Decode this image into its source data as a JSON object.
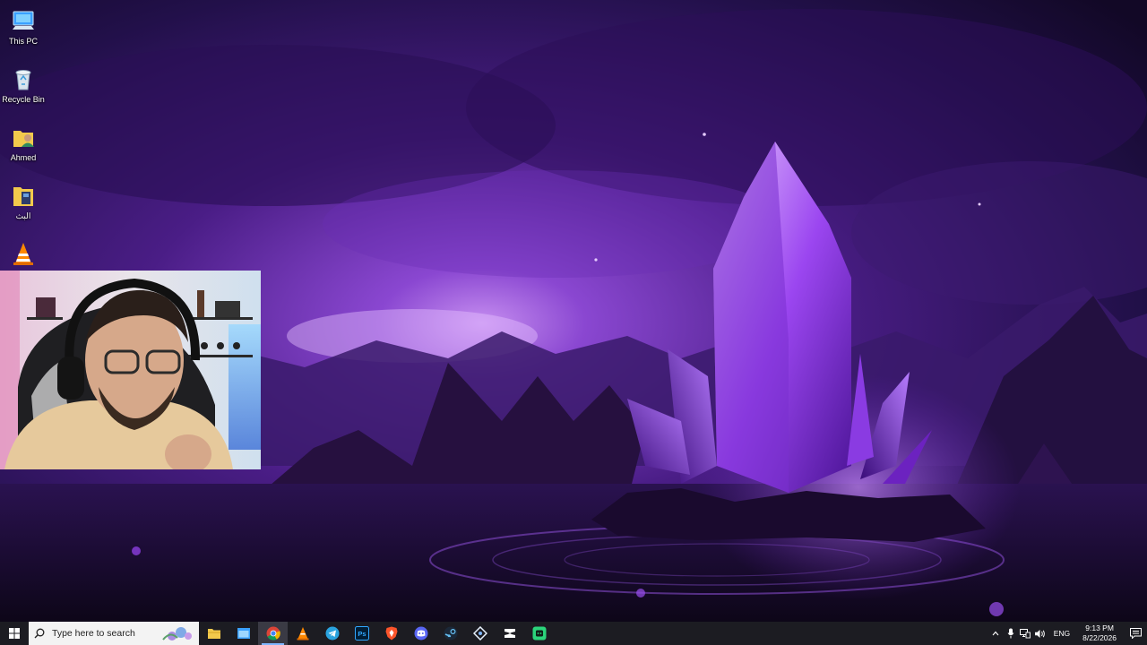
{
  "desktop": {
    "icons": [
      {
        "label": "This PC",
        "icon": "this-pc-icon"
      },
      {
        "label": "Recycle Bin",
        "icon": "recycle-bin-icon"
      },
      {
        "label": "Ahmed",
        "icon": "user-folder-icon"
      },
      {
        "label": "البث",
        "icon": "folder-icon"
      },
      {
        "label": "",
        "icon": "vlc-icon"
      }
    ]
  },
  "taskbar": {
    "search_placeholder": "Type here to search",
    "apps": [
      {
        "name": "file-explorer",
        "icon": "folder-icon"
      },
      {
        "name": "desktop-app",
        "icon": "window-icon"
      },
      {
        "name": "chrome",
        "icon": "chrome-icon",
        "active": true
      },
      {
        "name": "vlc",
        "icon": "vlc-icon"
      },
      {
        "name": "telegram",
        "icon": "telegram-icon"
      },
      {
        "name": "photoshop",
        "icon": "photoshop-icon",
        "text": "Ps"
      },
      {
        "name": "brave",
        "icon": "brave-icon"
      },
      {
        "name": "discord",
        "icon": "discord-icon"
      },
      {
        "name": "steam",
        "icon": "steam-icon"
      },
      {
        "name": "network-app",
        "icon": "diamond-icon"
      },
      {
        "name": "capcut",
        "icon": "capcut-icon"
      },
      {
        "name": "green-app",
        "icon": "green-app-icon"
      }
    ],
    "tray": {
      "language": "ENG",
      "time": "9:13 PM",
      "date": "8/22/2026"
    }
  },
  "colors": {
    "taskbar": "#1c1c22",
    "accent": "#7fb6ff",
    "wallpaper_primary": "#5a1fa8",
    "crystal": "#b46cff"
  }
}
